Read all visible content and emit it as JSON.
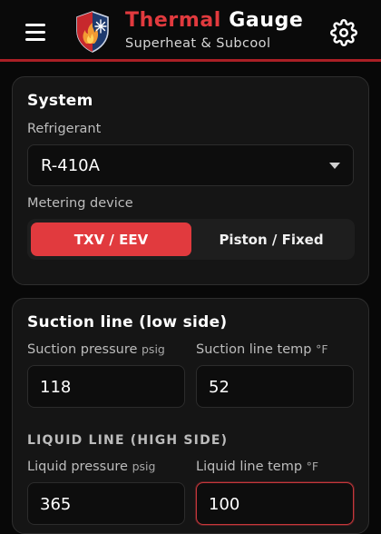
{
  "header": {
    "title_part1": "Thermal",
    "title_part2": "Gauge",
    "subtitle": "Superheat & Subcool",
    "menu_icon": "hamburger-menu-icon",
    "logo_icon": "shield-flame-snowflake-logo",
    "settings_icon": "gear-icon"
  },
  "colors": {
    "accent": "#e13a3e",
    "header_border": "#a91f25",
    "card_bg": "#151515",
    "input_bg": "#0d0d0d"
  },
  "system": {
    "title": "System",
    "refrigerant_label": "Refrigerant",
    "refrigerant_value": "R-410A",
    "metering_label": "Metering device",
    "metering_options": [
      "TXV / EEV",
      "Piston / Fixed"
    ],
    "metering_selected": "TXV / EEV"
  },
  "suction": {
    "title": "Suction line (low side)",
    "pressure_label": "Suction pressure",
    "pressure_unit": "psig",
    "pressure_value": "118",
    "temp_label": "Suction line temp",
    "temp_unit": "°F",
    "temp_value": "52"
  },
  "liquid": {
    "title": "LIQUID LINE (HIGH SIDE)",
    "pressure_label": "Liquid pressure",
    "pressure_unit": "psig",
    "pressure_value": "365",
    "temp_label": "Liquid line temp",
    "temp_unit": "°F",
    "temp_value": "100"
  }
}
